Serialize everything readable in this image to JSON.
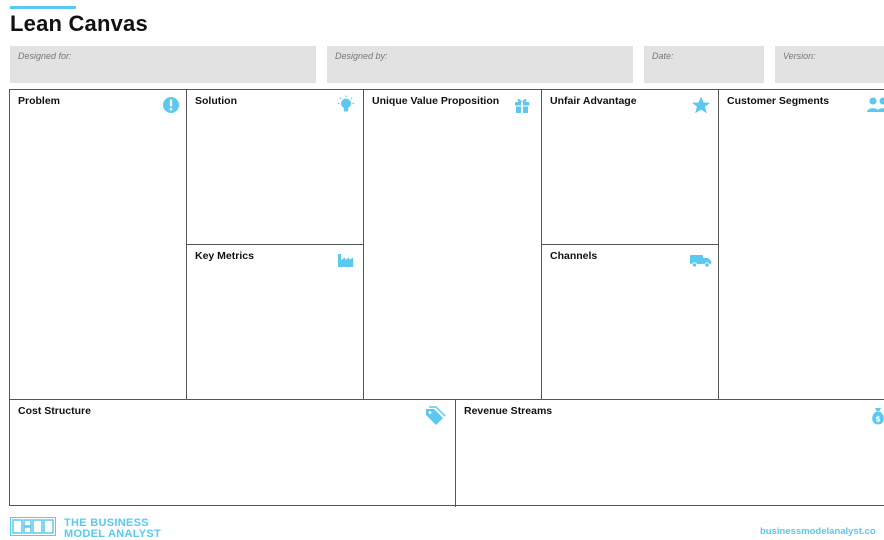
{
  "header": {
    "title": "Lean Canvas"
  },
  "meta": {
    "designed_for_label": "Designed for:",
    "designed_by_label": "Designed by:",
    "date_label": "Date:",
    "version_label": "Version:"
  },
  "blocks": {
    "problem": "Problem",
    "solution": "Solution",
    "unique_value_proposition": "Unique Value Proposition",
    "unfair_advantage": "Unfair Advantage",
    "customer_segments": "Customer Segments",
    "key_metrics": "Key Metrics",
    "channels": "Channels",
    "cost_structure": "Cost Structure",
    "revenue_streams": "Revenue Streams"
  },
  "footer": {
    "brand_line1": "THE BUSINESS",
    "brand_line2": "MODEL ANALYST",
    "url": "businessmodelanalyst.co"
  },
  "colors": {
    "accent": "#5bc8ef",
    "meta_fill": "#e2e2e2",
    "border": "#555555"
  },
  "icons": {
    "problem": "exclamation-icon",
    "solution": "lightbulb-icon",
    "unique_value_proposition": "gift-icon",
    "unfair_advantage": "star-icon",
    "customer_segments": "users-icon",
    "key_metrics": "factory-icon",
    "channels": "truck-icon",
    "cost_structure": "price-tag-icon",
    "revenue_streams": "money-bag-icon"
  }
}
